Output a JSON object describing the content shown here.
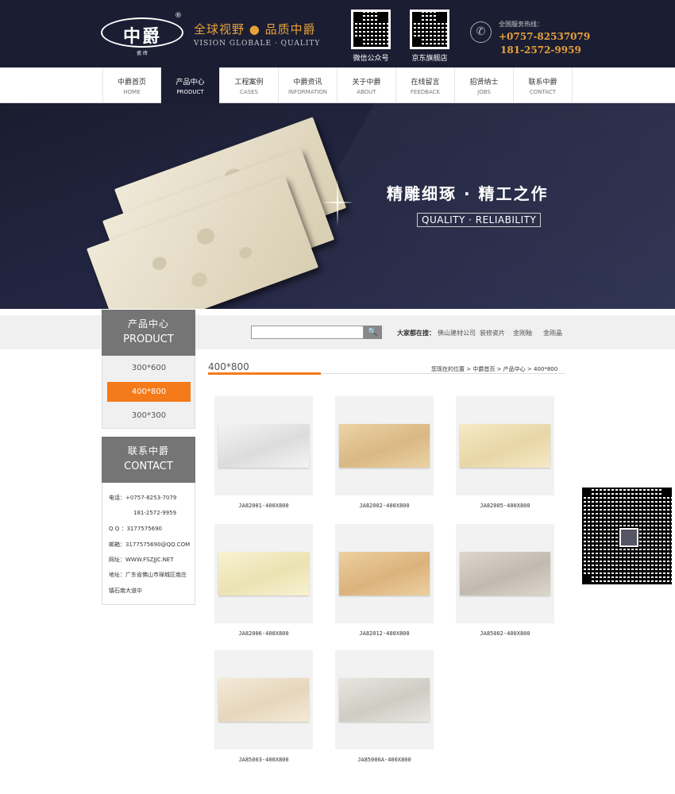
{
  "header": {
    "logo_text": "中爵",
    "logo_sub": "瓷 砖",
    "reg_mark": "®",
    "slogan": "全球视野 ● 品质中爵",
    "slogan_en": "VISION GLOBALE · QUALITY",
    "qr_wechat_label": "微信公众号",
    "qr_jd_label": "京东旗舰店",
    "hotline_label": "全国服务热线：",
    "hotline_1": "+0757-82537079",
    "hotline_2": "181-2572-9959",
    "phone_glyph": "✆"
  },
  "nav": [
    {
      "cn": "中爵首页",
      "en": "HOME"
    },
    {
      "cn": "产品中心",
      "en": "PRODUCT"
    },
    {
      "cn": "工程案例",
      "en": "CASES"
    },
    {
      "cn": "中爵资讯",
      "en": "INFORMATION"
    },
    {
      "cn": "关于中爵",
      "en": "ABOUT"
    },
    {
      "cn": "在线留言",
      "en": "FEEDBACK"
    },
    {
      "cn": "招贤纳士",
      "en": "JOBS"
    },
    {
      "cn": "联系中爵",
      "en": "CONTACT"
    }
  ],
  "nav_active_index": 1,
  "banner": {
    "title": "精雕细琢 · 精工之作",
    "subtitle": "QUALITY · RELIABILITY"
  },
  "search": {
    "placeholder": "",
    "button_glyph": "🔍",
    "hot_label": "大家都在搜：",
    "hot_links": [
      "佛山建材公司",
      "装修瓷片",
      "金刚釉",
      "金刚晶"
    ]
  },
  "sidebar": {
    "product_head_cn": "产品中心",
    "product_head_en": "PRODUCT",
    "categories": [
      "300*600",
      "400*800",
      "300*300"
    ],
    "active_category_index": 1,
    "contact_head_cn": "联系中爵",
    "contact_head_en": "CONTACT",
    "contact_lines": [
      "电话：+0757-8253-7079",
      "181-2572-9959",
      "Q Q ：3177575690",
      "邮箱：3177575690@QQ.COM",
      "网址：WWW.FSZJJC.NET",
      "地址：广东省佛山市禅城区南庄",
      "镇石南大道中"
    ]
  },
  "main": {
    "section_title": "400*800",
    "crumb_prefix": "您现在的位置",
    "crumb_items": [
      "中爵首页",
      "产品中心",
      "400*800"
    ],
    "crumb_sep": " > ",
    "products": [
      {
        "label": "JA82001-400X800",
        "color_a": "#f4f4f4",
        "color_b": "#dcdcdc"
      },
      {
        "label": "JA82002-400X800",
        "color_a": "#ecd3a4",
        "color_b": "#d9b884"
      },
      {
        "label": "JA82005-400X800",
        "color_a": "#f5e9c6",
        "color_b": "#e8d6a6"
      },
      {
        "label": "JA82006-400X800",
        "color_a": "#f7f2d2",
        "color_b": "#ece2b2"
      },
      {
        "label": "JA82012-400X800",
        "color_a": "#ecd0a0",
        "color_b": "#dcb27c"
      },
      {
        "label": "JA85002-400X800",
        "color_a": "#ddd6cc",
        "color_b": "#c2bab0"
      },
      {
        "label": "JA85003-400X800",
        "color_a": "#f4ead8",
        "color_b": "#e6d6bc"
      },
      {
        "label": "JA85006A-400X800",
        "color_a": "#e8e6e0",
        "color_b": "#cfccc4"
      }
    ]
  }
}
